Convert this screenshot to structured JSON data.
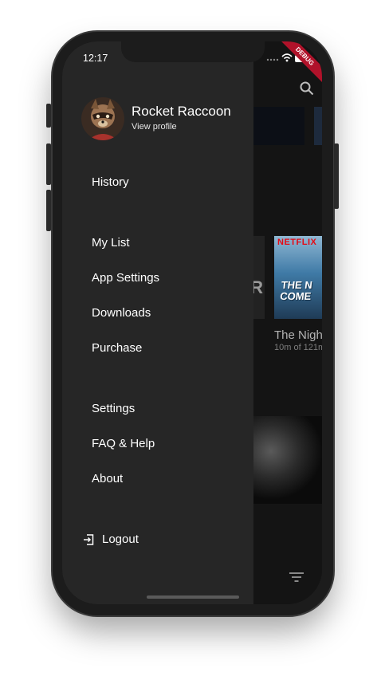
{
  "status_bar": {
    "time": "12:17",
    "debug_label": "DEBUG"
  },
  "profile": {
    "name": "Rocket Raccoon",
    "link": "View profile"
  },
  "menu": {
    "history": "History",
    "my_list": "My List",
    "app_settings": "App Settings",
    "downloads": "Downloads",
    "purchase": "Purchase",
    "settings": "Settings",
    "faq_help": "FAQ & Help",
    "about": "About",
    "logout": "Logout"
  },
  "background": {
    "netflix_logo": "NETFLIX",
    "card_art_text_line1": "THE N",
    "card_art_text_line2": "COME",
    "left_card_letter": "R",
    "item_title": "The Nigh",
    "item_progress": "10m of 121m"
  },
  "icons": [
    "search-icon",
    "filter-icon",
    "logout-icon",
    "wifi-icon",
    "battery-icon",
    "signal-icon"
  ],
  "colors": {
    "drawer": "#262626",
    "background": "#141414",
    "debug_ribbon": "#b0122a",
    "netflix_red": "#e50914"
  }
}
